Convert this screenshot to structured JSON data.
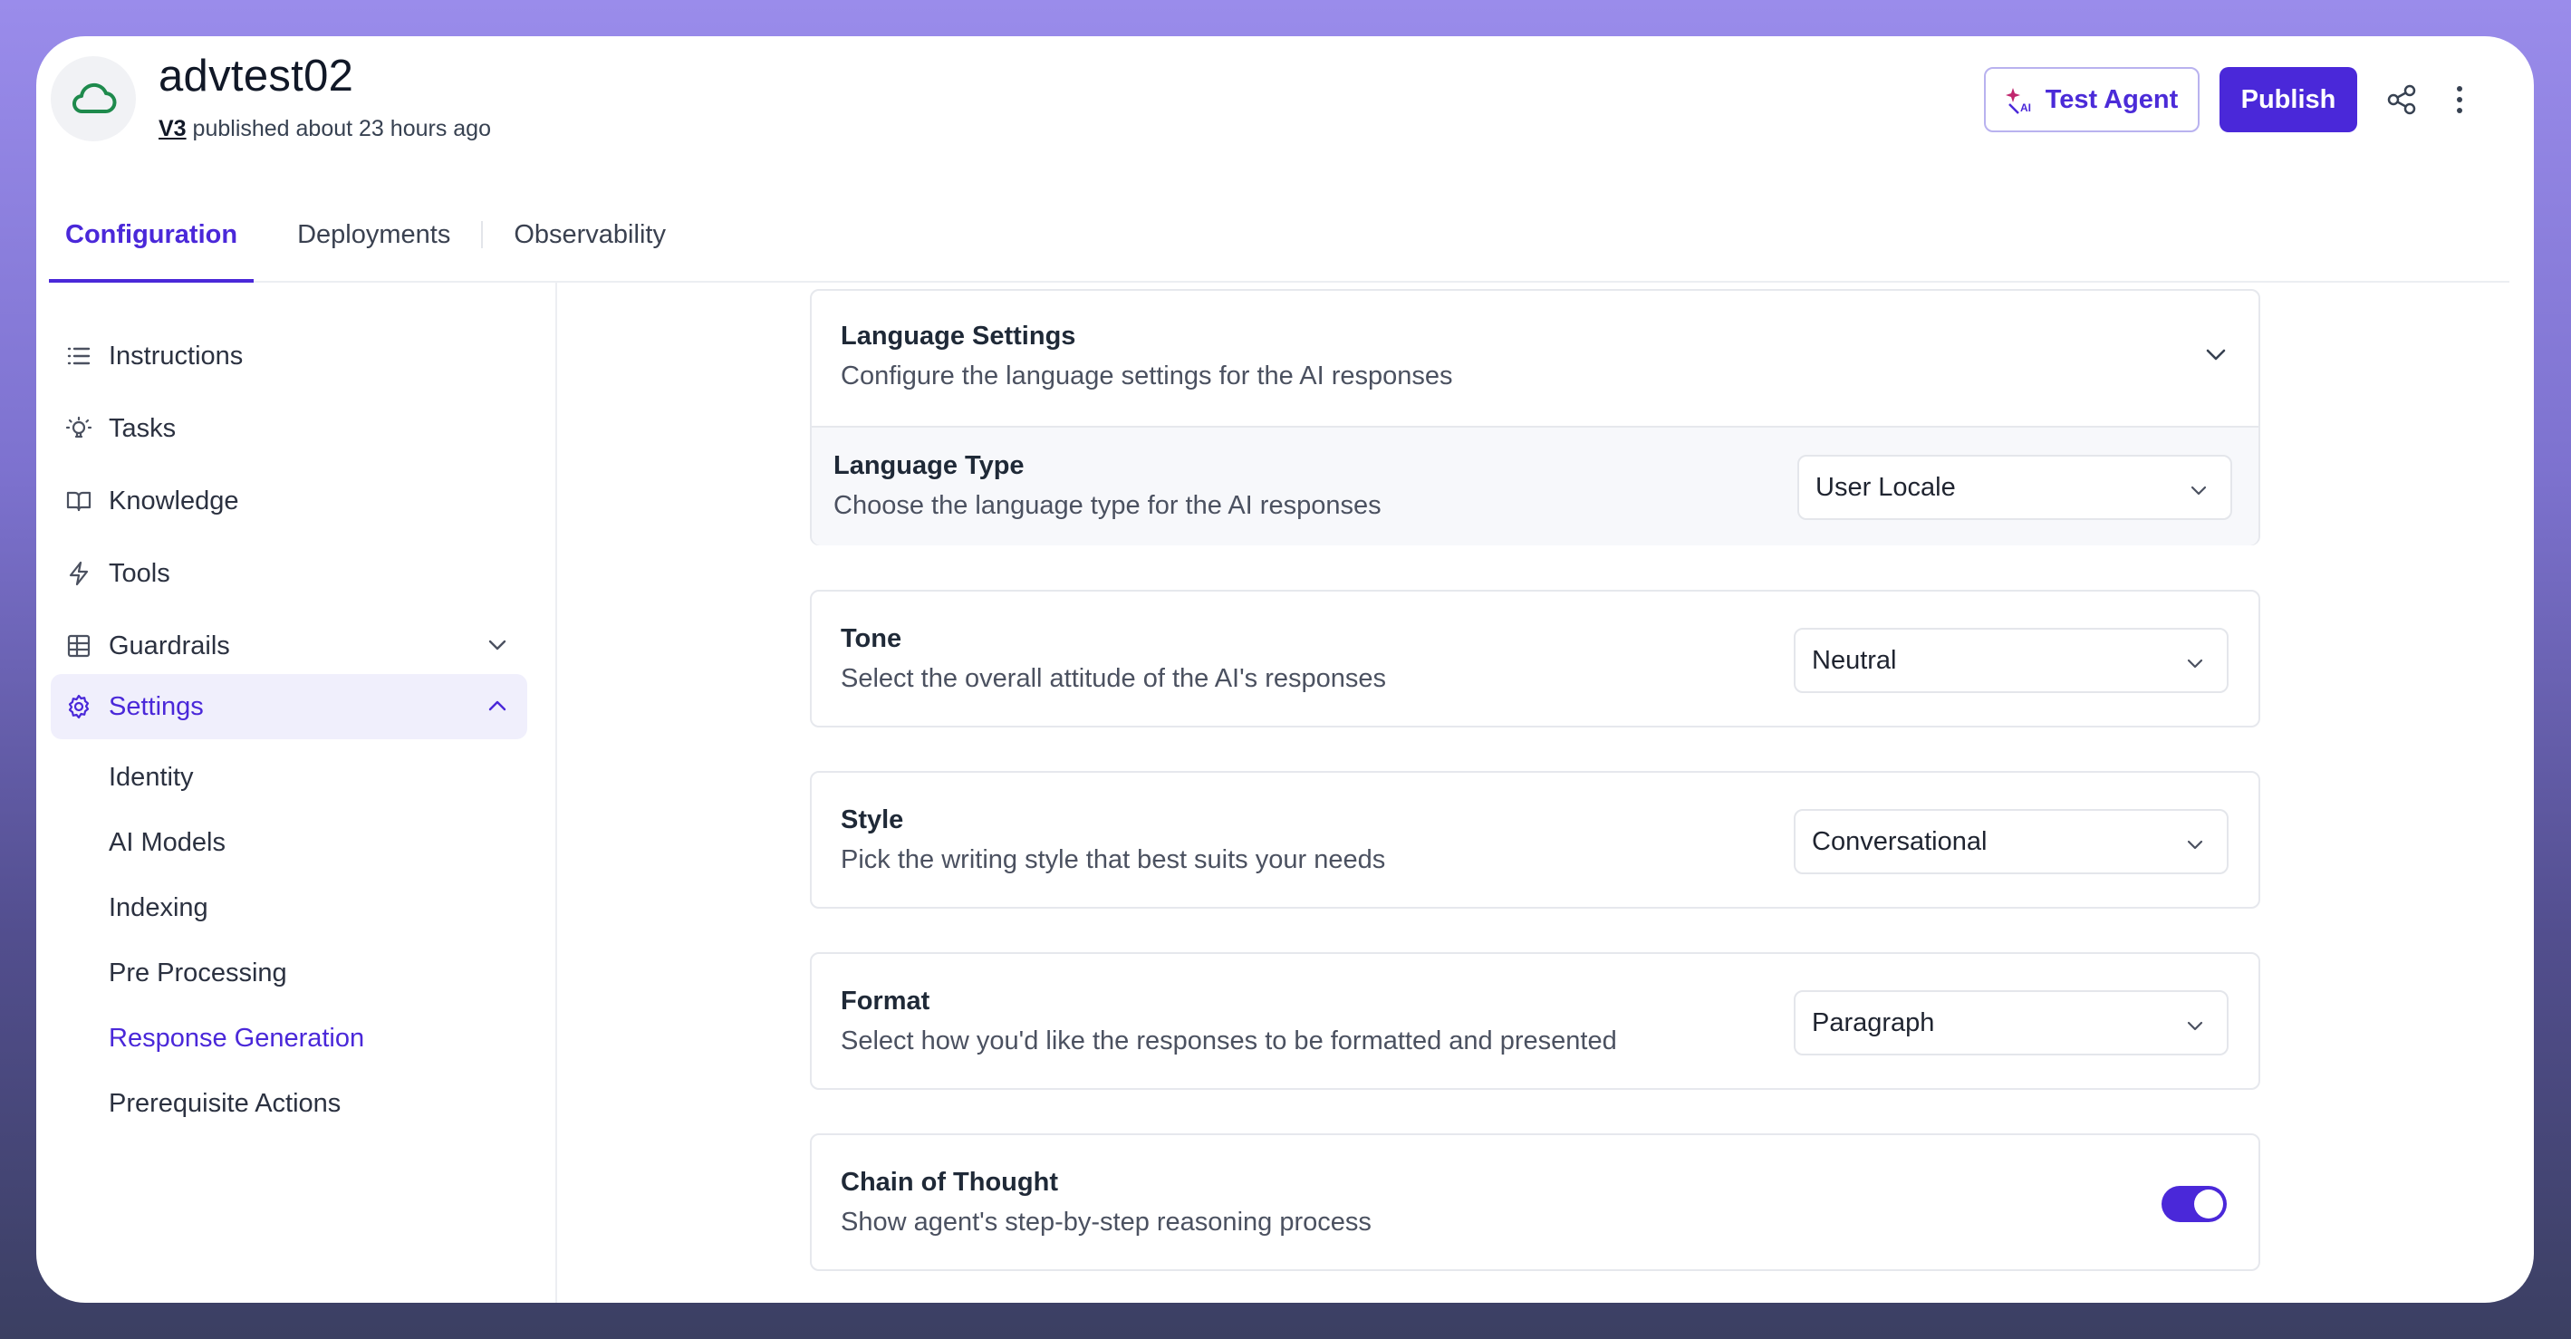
{
  "app": {
    "name": "advtest02",
    "version": "V3",
    "published_text": "published about 23 hours ago"
  },
  "header": {
    "test_agent_label": "Test Agent",
    "publish_label": "Publish"
  },
  "tabs": [
    {
      "label": "Configuration",
      "active": true
    },
    {
      "label": "Deployments",
      "active": false
    },
    {
      "label": "Observability",
      "active": false
    }
  ],
  "sidebar": {
    "items": [
      {
        "label": "Instructions",
        "icon": "list-icon"
      },
      {
        "label": "Tasks",
        "icon": "lightbulb-icon"
      },
      {
        "label": "Knowledge",
        "icon": "book-icon"
      },
      {
        "label": "Tools",
        "icon": "lightning-icon"
      },
      {
        "label": "Guardrails",
        "icon": "grid-icon"
      },
      {
        "label": "Settings",
        "icon": "gear-icon",
        "active": true
      }
    ],
    "settings_sub": [
      {
        "label": "Identity"
      },
      {
        "label": "AI Models"
      },
      {
        "label": "Indexing"
      },
      {
        "label": "Pre Processing"
      },
      {
        "label": "Response Generation",
        "active": true
      },
      {
        "label": "Prerequisite Actions"
      }
    ]
  },
  "main": {
    "language": {
      "title": "Language Settings",
      "desc": "Configure the language settings for the AI responses",
      "type_title": "Language Type",
      "type_desc": "Choose the language type for the AI responses",
      "type_value": "User Locale"
    },
    "tone": {
      "title": "Tone",
      "desc": "Select the overall attitude of the AI's responses",
      "value": "Neutral"
    },
    "style": {
      "title": "Style",
      "desc": "Pick the writing style that best suits your needs",
      "value": "Conversational"
    },
    "format": {
      "title": "Format",
      "desc": "Select how you'd like the responses to be formatted and presented",
      "value": "Paragraph"
    },
    "chain_of_thought": {
      "title": "Chain of Thought",
      "desc": "Show agent's step-by-step reasoning process",
      "enabled": true
    }
  },
  "colors": {
    "accent": "#4a28d9",
    "background_gradient_top": "#9a8ceb",
    "background_gradient_bottom": "#3b3f62"
  }
}
